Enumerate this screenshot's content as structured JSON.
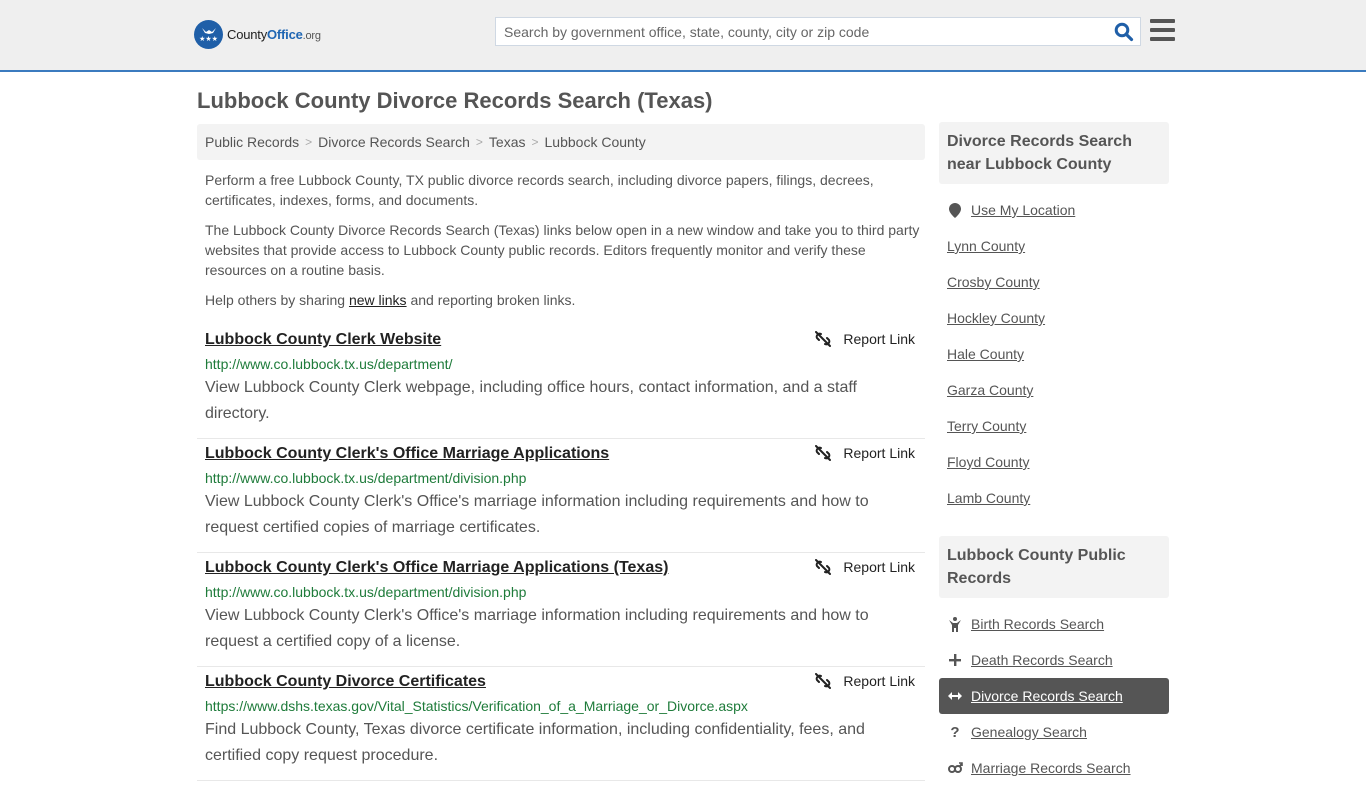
{
  "header": {
    "logo": {
      "name_part1": "County",
      "name_part2": "Office",
      "tld": ".org"
    },
    "search": {
      "placeholder": "Search by government office, state, county, city or zip code",
      "value": ""
    },
    "search_icon": "search-icon",
    "menu_icon": "hamburger-menu-icon"
  },
  "page": {
    "title": "Lubbock County Divorce Records Search (Texas)"
  },
  "breadcrumb": [
    {
      "label": "Public Records"
    },
    {
      "label": "Divorce Records Search"
    },
    {
      "label": "Texas"
    },
    {
      "label": "Lubbock County"
    }
  ],
  "intro": {
    "p1": "Perform a free Lubbock County, TX public divorce records search, including divorce papers, filings, decrees, certificates, indexes, forms, and documents.",
    "p2": "The Lubbock County Divorce Records Search (Texas) links below open in a new window and take you to third party websites that provide access to Lubbock County public records. Editors frequently monitor and verify these resources on a routine basis.",
    "p3_before": "Help others by sharing ",
    "p3_link": "new links",
    "p3_after": " and reporting broken links."
  },
  "report_label": "Report Link",
  "results": [
    {
      "title": "Lubbock County Clerk Website",
      "url": "http://www.co.lubbock.tx.us/department/",
      "description": "View Lubbock County Clerk webpage, including office hours, contact information, and a staff directory."
    },
    {
      "title": "Lubbock County Clerk's Office Marriage Applications",
      "url": "http://www.co.lubbock.tx.us/department/division.php",
      "description": "View Lubbock County Clerk's Office's marriage information including requirements and how to request certified copies of marriage certificates."
    },
    {
      "title": "Lubbock County Clerk's Office Marriage Applications (Texas)",
      "url": "http://www.co.lubbock.tx.us/department/division.php",
      "description": "View Lubbock County Clerk's Office's marriage information including requirements and how to request a certified copy of a license."
    },
    {
      "title": "Lubbock County Divorce Certificates",
      "url": "https://www.dshs.texas.gov/Vital_Statistics/Verification_of_a_Marriage_or_Divorce.aspx",
      "description": "Find Lubbock County, Texas divorce certificate information, including confidentiality, fees, and certified copy request procedure."
    }
  ],
  "sidebar": {
    "nearby": {
      "heading": "Divorce Records Search near Lubbock County",
      "use_location": "Use My Location",
      "counties": [
        "Lynn County",
        "Crosby County",
        "Hockley County",
        "Hale County",
        "Garza County",
        "Terry County",
        "Floyd County",
        "Lamb County"
      ]
    },
    "public_records": {
      "heading": "Lubbock County Public Records",
      "items": [
        {
          "label": "Birth Records Search",
          "icon": "child-icon",
          "active": false
        },
        {
          "label": "Death Records Search",
          "icon": "plus-icon",
          "active": false
        },
        {
          "label": "Divorce Records Search",
          "icon": "left-right-arrow-icon",
          "active": true
        },
        {
          "label": "Genealogy Search",
          "icon": "question-icon",
          "active": false
        },
        {
          "label": "Marriage Records Search",
          "icon": "gender-icon",
          "active": false
        }
      ]
    }
  },
  "colors": {
    "brand_blue": "#1f66b3",
    "header_border": "#3b7bbf",
    "url_green": "#1e7b3a",
    "active_item_bg": "#555555"
  }
}
